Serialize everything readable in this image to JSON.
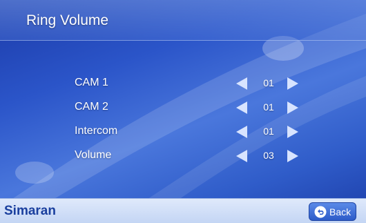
{
  "title": "Ring Volume",
  "settings": [
    {
      "label": "CAM 1",
      "value": "01"
    },
    {
      "label": "CAM 2",
      "value": "01"
    },
    {
      "label": "Intercom",
      "value": "01"
    },
    {
      "label": "Volume",
      "value": "03"
    }
  ],
  "footer": {
    "brand": "Simaran",
    "back_label": "Back",
    "back_icon": "back-arrow-icon"
  },
  "colors": {
    "background": "#2b55c9",
    "arrow": "#d8e4ff",
    "footer": "#c3d5f4",
    "brand": "#1a3f9e",
    "button": "#2d5bc8"
  }
}
